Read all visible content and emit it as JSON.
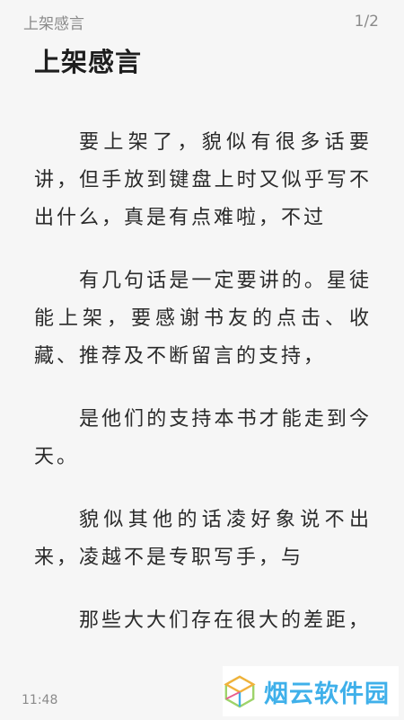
{
  "header": {
    "book_title": "上架感言",
    "page_indicator": "1/2"
  },
  "chapter": {
    "title": "上架感言",
    "paragraphs": [
      "要上架了，貌似有很多话要讲，但手放到键盘上时又似乎写不出什么，真是有点难啦，不过",
      "有几句话是一定要讲的。星徒能上架，要感谢书友的点击、收藏、推荐及不断留言的支持，",
      "是他们的支持本书才能走到今天。",
      "貌似其他的话凌好象说不出来，凌越不是专职写手，与",
      "那些大大们存在很大的差距，"
    ]
  },
  "footer": {
    "time": "11:48"
  },
  "watermark": {
    "text": "烟云软件园",
    "color": "#3fb0ea"
  }
}
